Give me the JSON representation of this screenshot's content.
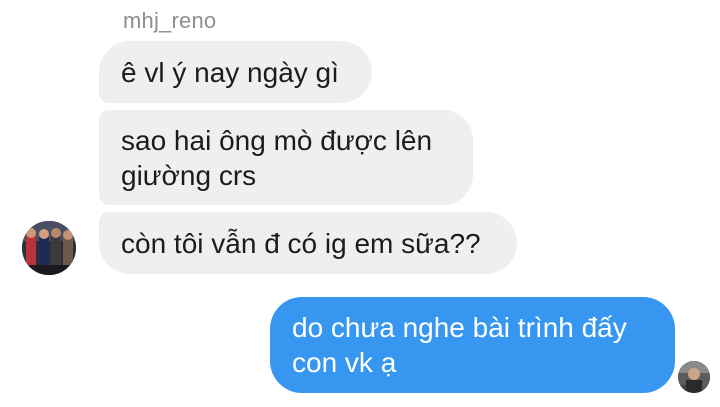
{
  "thread": {
    "sender_name": "mhj_reno",
    "incoming": [
      {
        "text": "ê vl ý nay ngày gì"
      },
      {
        "text": "sao hai ông mò được lên\ngiường crs"
      },
      {
        "text": "còn tôi vẫn đ có ig em sữa??"
      }
    ],
    "outgoing": [
      {
        "text": "do chưa nghe bài trình đấy\ncon vk ạ"
      }
    ]
  },
  "colors": {
    "incoming_bubble": "#efeff0",
    "outgoing_bubble": "#3797f0",
    "sender_name": "#8e8e93"
  }
}
